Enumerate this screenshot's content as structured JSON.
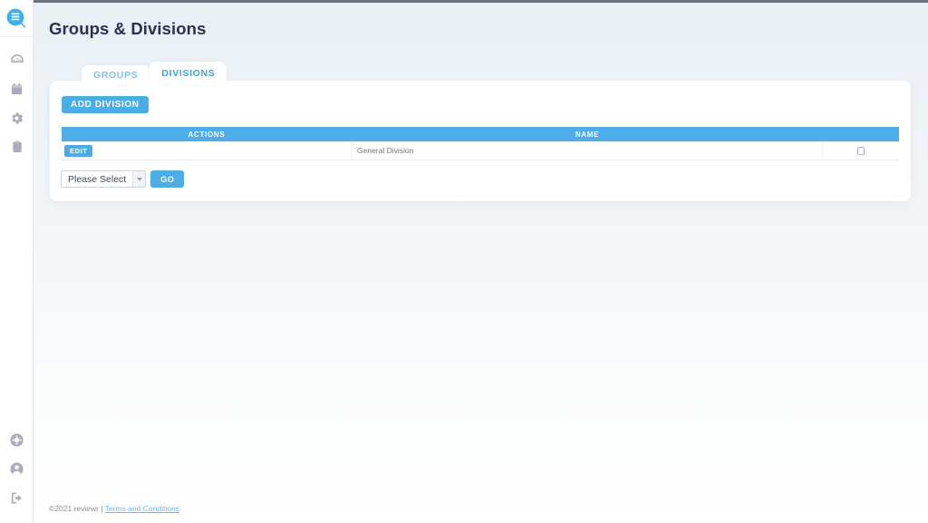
{
  "sidebar": {
    "logo": {
      "name": "reviewr-logo",
      "icon": "speech-bubble-logo-icon"
    },
    "top_items": [
      {
        "id": "dashboard",
        "icon": "gauge-icon",
        "label": "Dashboard"
      },
      {
        "id": "calendar",
        "icon": "calendar-icon",
        "label": "Calendar"
      },
      {
        "id": "settings",
        "icon": "gear-icon",
        "label": "Settings"
      },
      {
        "id": "reports",
        "icon": "clipboard-icon",
        "label": "Reports"
      }
    ],
    "bottom_items": [
      {
        "id": "help",
        "icon": "life-ring-icon",
        "label": "Help"
      },
      {
        "id": "account",
        "icon": "user-circle-icon",
        "label": "Account"
      },
      {
        "id": "logout",
        "icon": "logout-icon",
        "label": "Log Out"
      }
    ]
  },
  "header": {
    "title": "Groups & Divisions"
  },
  "tabs": [
    {
      "id": "groups",
      "label": "GROUPS",
      "active": false
    },
    {
      "id": "divisions",
      "label": "DIVISIONS",
      "active": true
    }
  ],
  "toolbar": {
    "add_division_label": "ADD DIVISION"
  },
  "table": {
    "columns": [
      "ACTIONS",
      "NAME"
    ],
    "rows": [
      {
        "action_label": "EDIT",
        "name": "General Division",
        "selected": false
      }
    ]
  },
  "bulk_action": {
    "select_value": "Please Select",
    "arrow_icon": "chevron-down-icon",
    "go_label": "GO"
  },
  "footer": {
    "copyright": "©2021 reviewr |",
    "link_label": "Terms and Conditions"
  },
  "colors": {
    "accent_blue": "#4cade4",
    "header_blue": "#4fadea",
    "tab_active": "#39a5e8",
    "tab_inactive": "#7cc2ef",
    "title_navy": "#2e2f52",
    "link_blue": "#6ab8e8"
  }
}
